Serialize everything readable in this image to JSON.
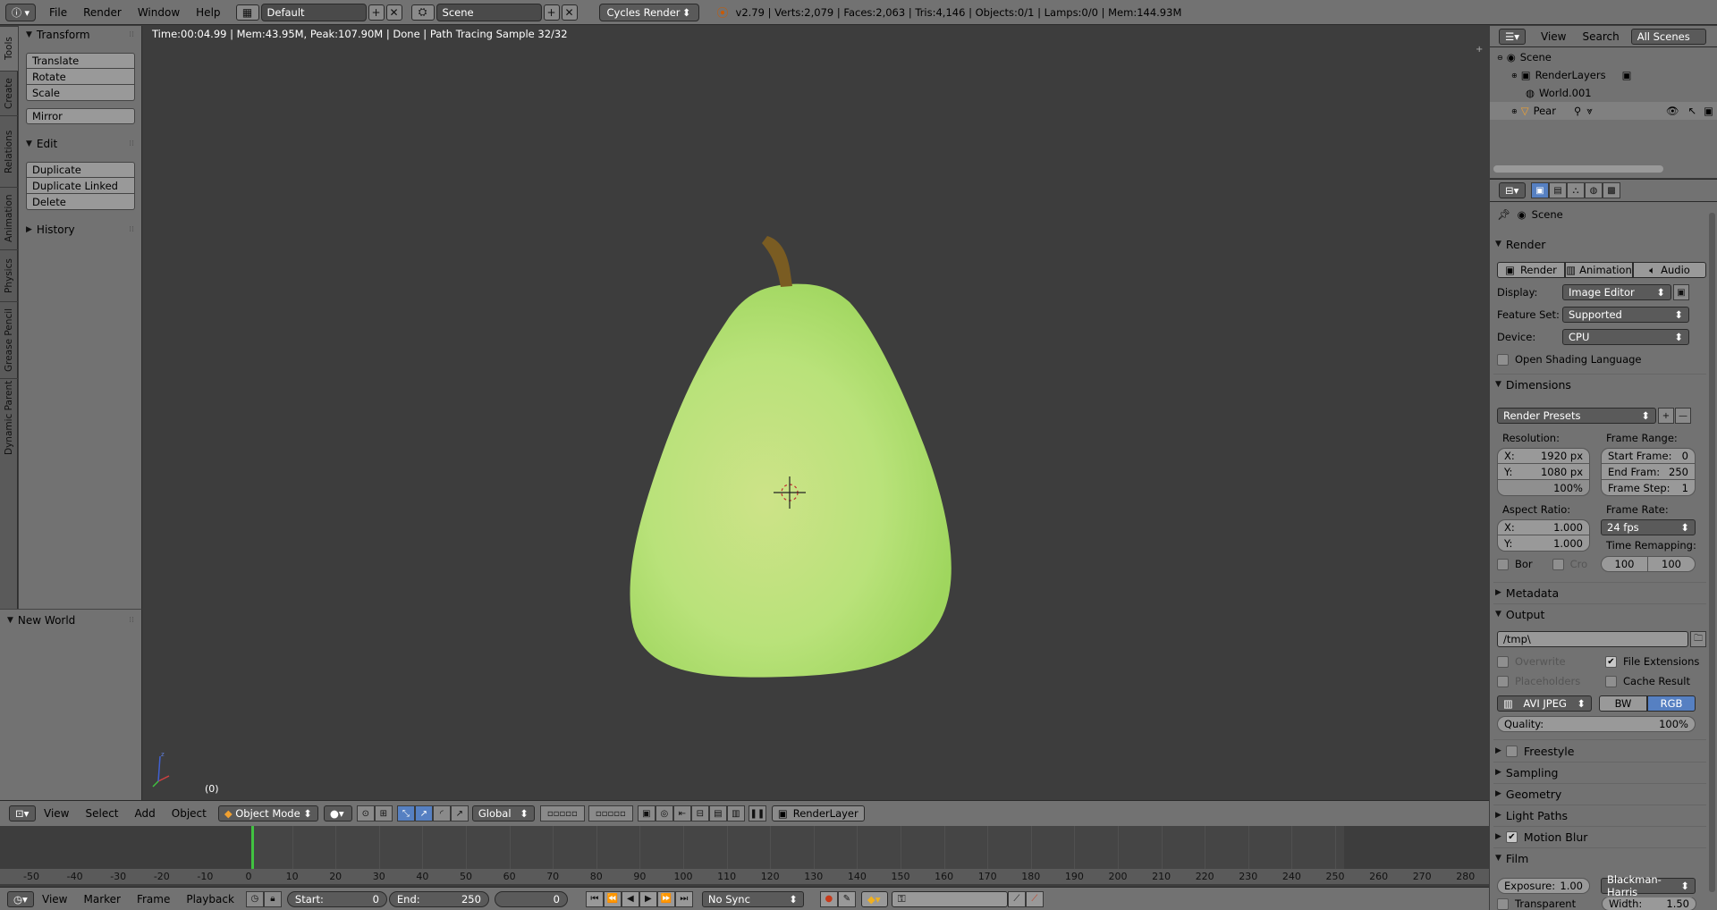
{
  "topbar": {
    "menus": [
      "File",
      "Render",
      "Window",
      "Help"
    ],
    "screen_layout": "Default",
    "scene": "Scene",
    "engine": "Cycles Render",
    "stats": "v2.79 | Verts:2,079 | Faces:2,063 | Tris:4,146 | Objects:0/1 | Lamps:0/0 | Mem:144.93M"
  },
  "vtabs": [
    "Tools",
    "Create",
    "Relations",
    "Animation",
    "Physics",
    "Grease Pencil",
    "Dynamic Parent"
  ],
  "toolshelf": {
    "transform_title": "Transform",
    "transform_buttons": [
      "Translate",
      "Rotate",
      "Scale"
    ],
    "mirror": "Mirror",
    "edit_title": "Edit",
    "edit_buttons": [
      "Duplicate",
      "Duplicate Linked",
      "Delete"
    ],
    "history_title": "History",
    "new_world": "New World"
  },
  "viewport": {
    "status": "Time:00:04.99 | Mem:43.95M, Peak:107.90M | Done | Path Tracing Sample 32/32",
    "frame_indicator": "(0)"
  },
  "view3d_header": {
    "menus": [
      "View",
      "Select",
      "Add",
      "Object"
    ],
    "mode": "Object Mode",
    "orientation": "Global",
    "render_layer": "RenderLayer"
  },
  "timeline": {
    "ruler_labels": [
      "-50",
      "-40",
      "-30",
      "-20",
      "-10",
      "0",
      "10",
      "20",
      "30",
      "40",
      "50",
      "60",
      "70",
      "80",
      "90",
      "100",
      "110",
      "120",
      "130",
      "140",
      "150",
      "160",
      "170",
      "180",
      "190",
      "200",
      "210",
      "220",
      "230",
      "240",
      "250",
      "260",
      "270",
      "280"
    ],
    "menus": [
      "View",
      "Marker",
      "Frame",
      "Playback"
    ],
    "start_label": "Start:",
    "start_value": "0",
    "end_label": "End:",
    "end_value": "250",
    "current_frame": "0",
    "sync": "No Sync"
  },
  "outliner": {
    "header_menus": [
      "View",
      "Search"
    ],
    "scope": "All Scenes",
    "items": [
      "Scene",
      "RenderLayers",
      "World.001",
      "Pear"
    ]
  },
  "properties": {
    "context": "Scene",
    "render_title": "Render",
    "render_buttons": [
      "Render",
      "Animation",
      "Audio"
    ],
    "display_label": "Display:",
    "display_value": "Image Editor",
    "feature_set_label": "Feature Set:",
    "feature_set_value": "Supported",
    "device_label": "Device:",
    "device_value": "CPU",
    "osl_label": "Open Shading Language",
    "dimensions_title": "Dimensions",
    "render_presets": "Render Presets",
    "resolution_label": "Resolution:",
    "res_x_label": "X:",
    "res_x": "1920 px",
    "res_y_label": "Y:",
    "res_y": "1080 px",
    "res_pct": "100%",
    "frame_range_label": "Frame Range:",
    "start_frame_label": "Start Frame:",
    "start_frame": "0",
    "end_frame_label": "End Fram:",
    "end_frame": "250",
    "frame_step_label": "Frame Step:",
    "frame_step": "1",
    "aspect_label": "Aspect Ratio:",
    "aspect_x_label": "X:",
    "aspect_x": "1.000",
    "aspect_y_label": "Y:",
    "aspect_y": "1.000",
    "frame_rate_label": "Frame Rate:",
    "frame_rate": "24 fps",
    "time_remap_label": "Time Remapping:",
    "remap_old": "100",
    "remap_new": "100",
    "border_label": "Bor",
    "crop_label": "Cro",
    "metadata_title": "Metadata",
    "output_title": "Output",
    "output_path": "/tmp\\",
    "overwrite_label": "Overwrite",
    "file_ext_label": "File Extensions",
    "placeholders_label": "Placeholders",
    "cache_label": "Cache Result",
    "file_format": "AVI JPEG",
    "color_bw": "BW",
    "color_rgb": "RGB",
    "quality_label": "Quality:",
    "quality_value": "100%",
    "freestyle_title": "Freestyle",
    "sampling_title": "Sampling",
    "geometry_title": "Geometry",
    "light_paths_title": "Light Paths",
    "motion_blur_title": "Motion Blur",
    "film_title": "Film",
    "exposure_label": "Exposure:",
    "exposure_value": "1.00",
    "filter_type": "Blackman-Harris",
    "transparent_label": "Transparent",
    "width_label": "Width:",
    "width_value": "1.50"
  },
  "colors": {
    "pear": "#b9e27a",
    "accent_blue": "#5680c2",
    "playhead": "#41c241"
  }
}
